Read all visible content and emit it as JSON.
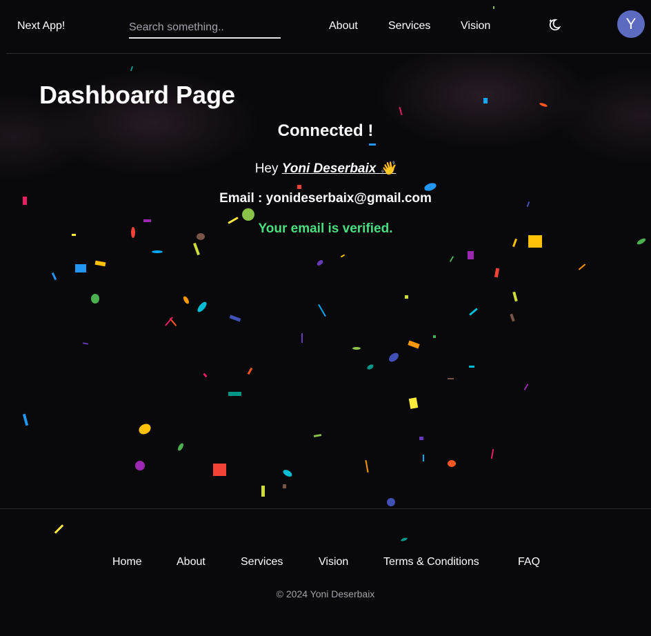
{
  "header": {
    "brand": "Next App!",
    "search_placeholder": "Search something..",
    "nav": [
      "About",
      "Services",
      "Vision"
    ],
    "theme_icon": "moon-stars-icon",
    "avatar_initial": "Y",
    "avatar_color": "#5c6bc0"
  },
  "main": {
    "title": "Dashboard Page",
    "status": "Connected !",
    "greeting_prefix": "Hey",
    "user_name": "Yoni Deserbaix",
    "wave_emoji": "👋",
    "email_label": "Email :",
    "email": "yonideserbaix@gmail.com",
    "verified_text": "Your email is verified.",
    "verified_color": "#4ade80"
  },
  "footer": {
    "links": [
      "Home",
      "About",
      "Services",
      "Vision",
      "Terms & Conditions",
      "FAQ"
    ],
    "copyright": "© 2024 Yoni Deserbaix"
  },
  "confetti_colors": [
    "#e91e63",
    "#2196f3",
    "#ffc107",
    "#4caf50",
    "#9c27b0",
    "#f44336",
    "#cddc39",
    "#795548",
    "#00bcd4",
    "#ff9800",
    "#3f51b5",
    "#009688",
    "#8bc34a",
    "#ffeb3b",
    "#673ab7",
    "#03a9f4",
    "#ff5722"
  ]
}
